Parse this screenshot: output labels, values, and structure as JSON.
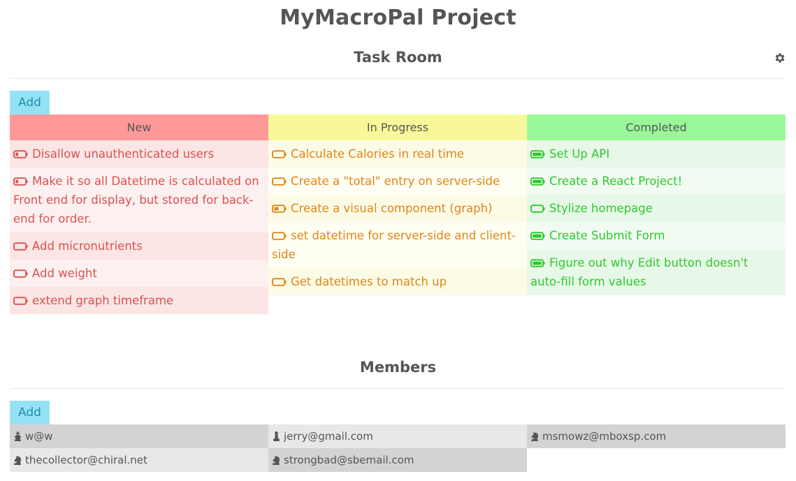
{
  "page": {
    "title": "MyMacroPal Project"
  },
  "task_room": {
    "title": "Task Room",
    "add_label": "Add",
    "settings_icon": "gear-icon",
    "columns": [
      {
        "label": "New",
        "header_color": "#ff9999",
        "row_colors": [
          "#fbe5e5",
          "#fdf0f0"
        ],
        "text_color": "#d9534f",
        "icon": "battery-low-icon",
        "tasks": [
          {
            "text": "Disallow unauthenticated users",
            "level": 0.3
          },
          {
            "text": "Make it so all Datetime is calculated on Front end for display, but stored for back-end for order.",
            "level": 0.3
          },
          {
            "text": "Add micronutrients",
            "level": 0
          },
          {
            "text": "Add weight",
            "level": 0
          },
          {
            "text": "extend graph timeframe",
            "level": 0
          }
        ]
      },
      {
        "label": "In Progress",
        "header_color": "#f8f89a",
        "row_colors": [
          "#fbfbe6",
          "#fefef2"
        ],
        "text_color": "#e0861a",
        "icon": "battery-half-icon",
        "tasks": [
          {
            "text": "Calculate Calories in real time",
            "level": 0
          },
          {
            "text": "Create a \"total\" entry on server-side",
            "level": 0
          },
          {
            "text": "Create a visual component (graph)",
            "level": 0.5
          },
          {
            "text": "set datetime for server-side and client-side",
            "level": 0
          },
          {
            "text": "Get datetimes to match up",
            "level": 0
          }
        ]
      },
      {
        "label": "Completed",
        "header_color": "#99f899",
        "row_colors": [
          "#e8f8e8",
          "#f2fbf2"
        ],
        "text_color": "#2ec92e",
        "icon": "battery-full-icon",
        "tasks": [
          {
            "text": "Set Up API",
            "level": 1
          },
          {
            "text": "Create a React Project!",
            "level": 1
          },
          {
            "text": "Stylize homepage",
            "level": 0
          },
          {
            "text": "Create Submit Form",
            "level": 1
          },
          {
            "text": "Figure out why Edit button doesn't auto-fill form values",
            "level": 1
          }
        ]
      }
    ]
  },
  "members_section": {
    "title": "Members",
    "add_label": "Add",
    "members": [
      {
        "email": "w@w",
        "icon": "chess-king-icon"
      },
      {
        "email": "jerry@gmail.com",
        "icon": "chess-pawn-icon"
      },
      {
        "email": "msmowz@mboxsp.com",
        "icon": "chess-knight-icon"
      },
      {
        "email": "thecollector@chiral.net",
        "icon": "chess-knight-icon"
      },
      {
        "email": "strongbad@sbemail.com",
        "icon": "chess-knight-icon"
      }
    ]
  }
}
